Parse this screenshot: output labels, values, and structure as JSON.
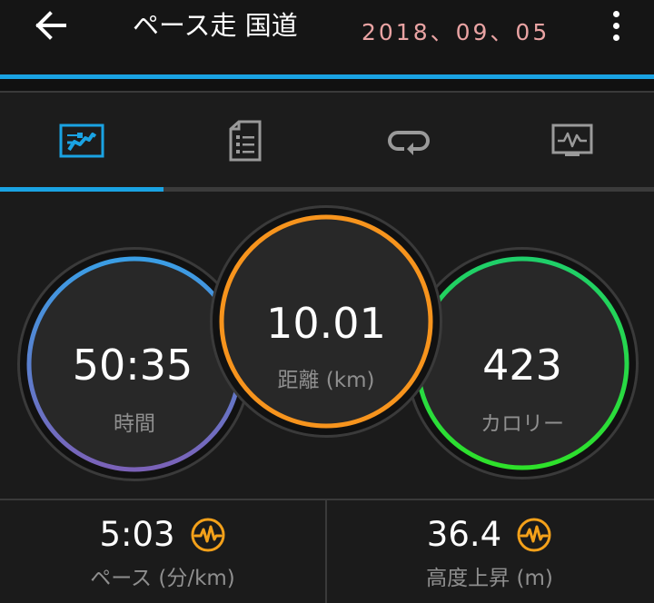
{
  "header": {
    "back_icon": "arrow-left-icon",
    "title": "ペース走 国道",
    "date": "2018、09、05",
    "menu_icon": "more-vertical-icon"
  },
  "tabs": [
    {
      "icon": "summary-chart-icon",
      "active": true
    },
    {
      "icon": "document-list-icon",
      "active": false
    },
    {
      "icon": "laps-loop-icon",
      "active": false
    },
    {
      "icon": "graph-monitor-icon",
      "active": false
    }
  ],
  "stats": {
    "time": {
      "value": "50:35",
      "label": "時間"
    },
    "distance": {
      "value": "10.01",
      "label": "距離 (km)"
    },
    "calories": {
      "value": "423",
      "label": "カロリー"
    }
  },
  "metrics": {
    "pace": {
      "value": "5:03",
      "label": "ペース (分/km)",
      "icon": "pace-wave-icon"
    },
    "elevation": {
      "value": "36.4",
      "label": "高度上昇 (m)",
      "icon": "pace-wave-icon"
    }
  },
  "colors": {
    "accent": "#1aa3e3",
    "date": "#e9a3a3",
    "time_ring_start": "#3a9ee5",
    "time_ring_end": "#7b62b8",
    "distance_ring": "#f7941d",
    "calories_ring_start": "#1fcf6a",
    "calories_ring_end": "#2ee12a",
    "metric_icon": "#f4a11a"
  }
}
